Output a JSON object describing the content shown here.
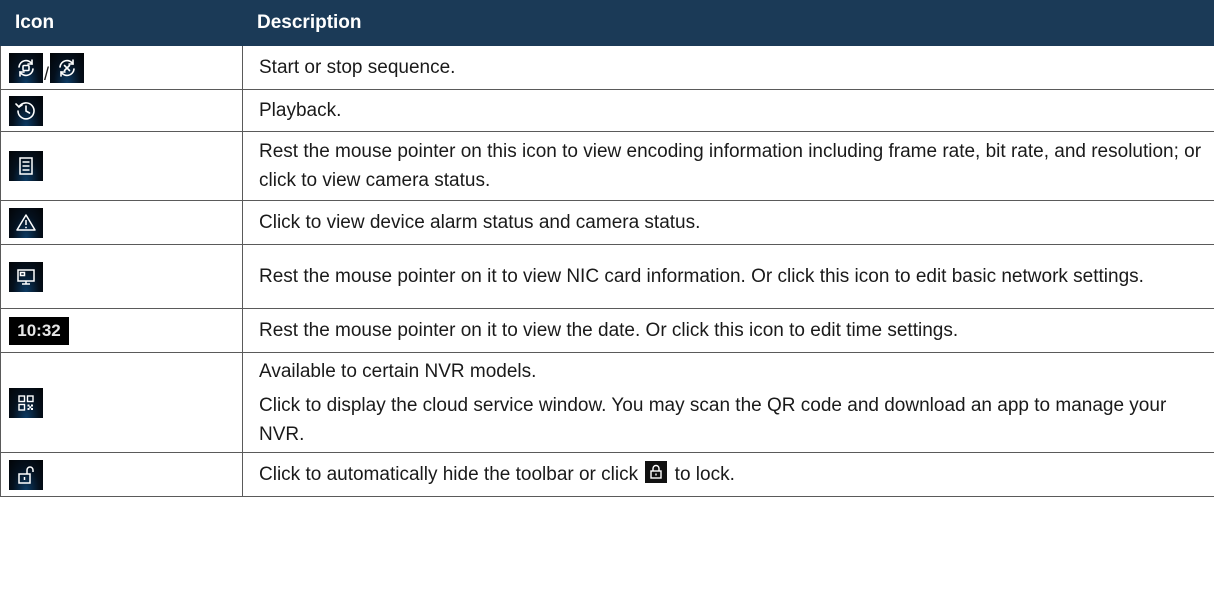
{
  "table": {
    "headers": {
      "icon": "Icon",
      "description": "Description"
    },
    "rows": [
      {
        "icon": "sequence-start-icon / sequence-stop-icon",
        "slash": "/",
        "description": "Start or stop sequence."
      },
      {
        "icon": "playback-clock-icon",
        "description": "Playback."
      },
      {
        "icon": "encoding-info-list-icon",
        "description": "Rest the mouse pointer on this icon to view encoding information including frame rate, bit rate, and resolution; or click to view camera status."
      },
      {
        "icon": "alarm-warning-icon",
        "description": "Click to view device alarm status and camera status."
      },
      {
        "icon": "network-monitor-icon",
        "description": "Rest the mouse pointer on it to view NIC card information. Or click this icon to edit basic network settings."
      },
      {
        "icon": "time-display",
        "time": "10:32",
        "description": "Rest the mouse pointer on it to view the date. Or click this icon to edit time settings."
      },
      {
        "icon": "qr-code-icon",
        "description_line1": "Available to certain NVR models.",
        "description_line2": "Click to display the cloud service window. You may scan the QR code and download an app to manage your NVR."
      },
      {
        "icon": "unlock-icon",
        "description_before": "Click to automatically hide the toolbar or click",
        "inline_icon": "lock-icon",
        "description_after": "to lock."
      }
    ]
  }
}
